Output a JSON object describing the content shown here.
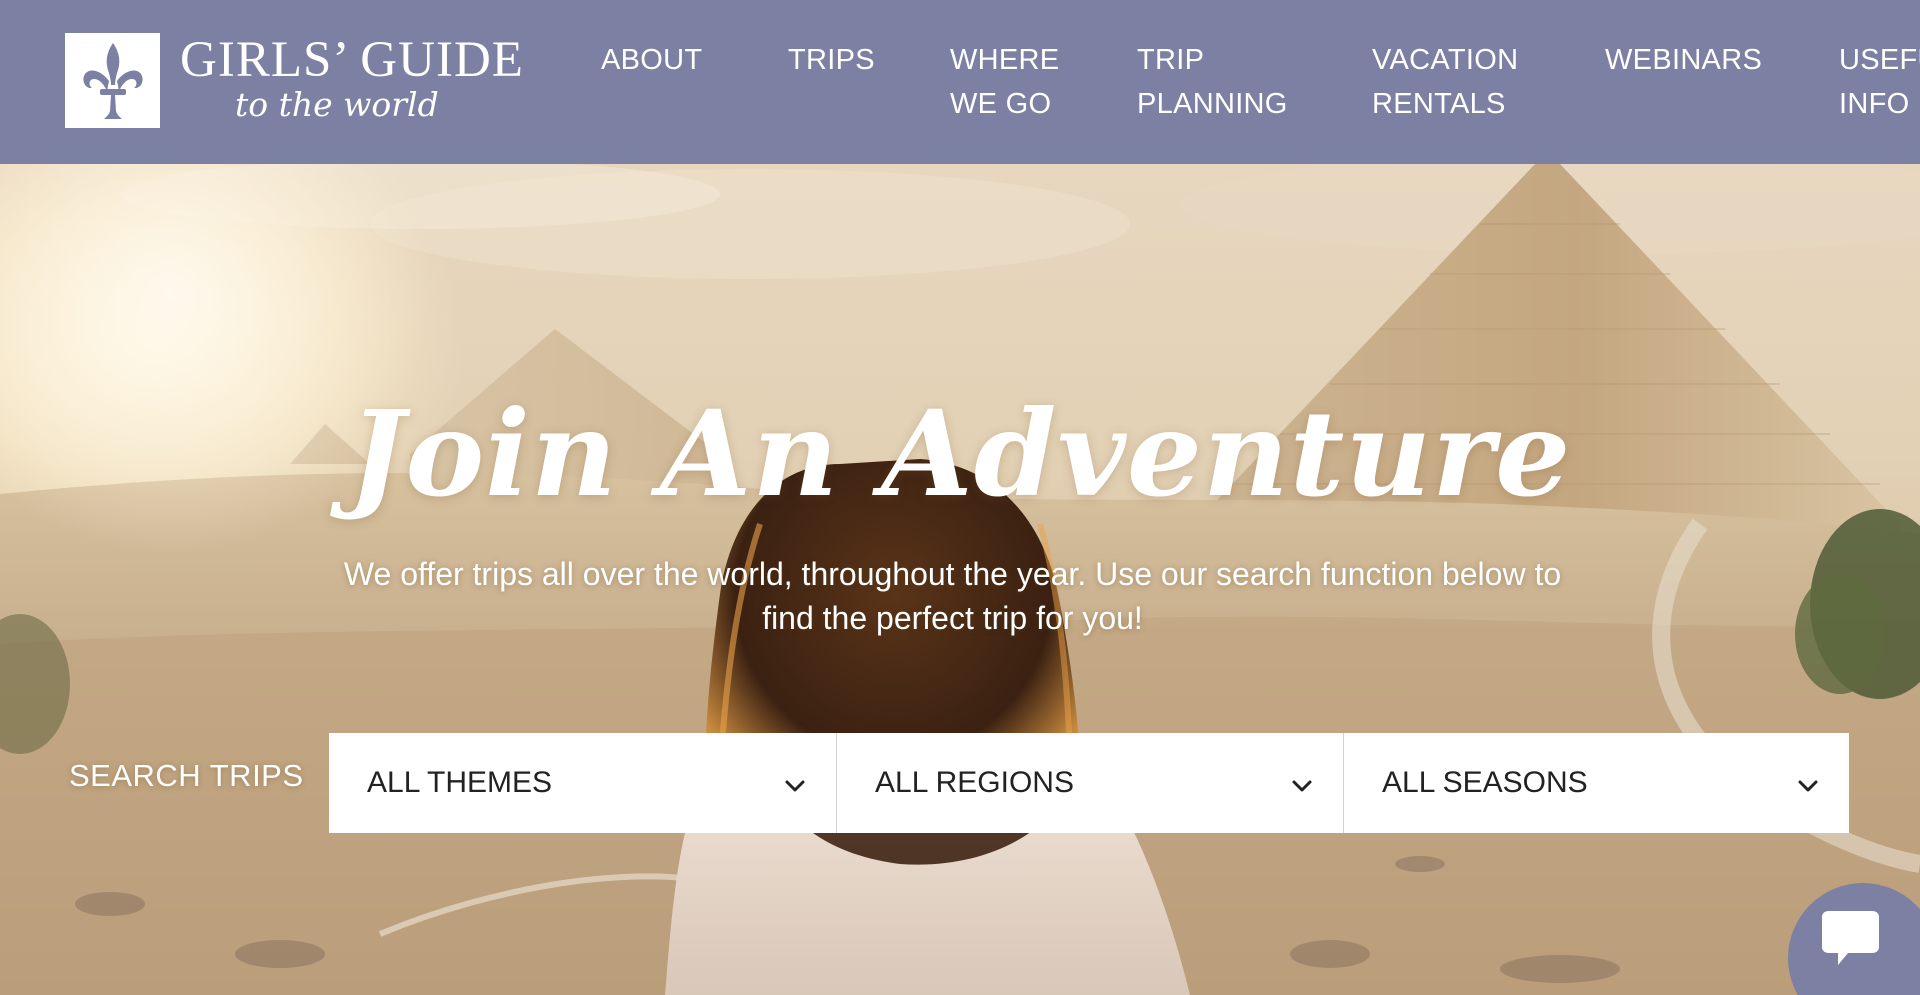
{
  "brand": {
    "logo_icon": "fleur-de-lis-icon",
    "name": "GIRLS’ GUIDE",
    "tagline": "to the world"
  },
  "nav": {
    "items": [
      {
        "line1": "ABOUT",
        "line2": ""
      },
      {
        "line1": "TRIPS",
        "line2": ""
      },
      {
        "line1": "WHERE",
        "line2": "WE GO"
      },
      {
        "line1": "TRIP",
        "line2": "PLANNING"
      },
      {
        "line1": "VACATION",
        "line2": "RENTALS"
      },
      {
        "line1": "WEBINARS",
        "line2": ""
      },
      {
        "line1": "USEFU",
        "line2": "INFO"
      }
    ]
  },
  "hero": {
    "title": "Join An Adventure",
    "subtitle": "We offer trips all over the world, throughout the year. Use our search function below to find the perfect trip for you!"
  },
  "search": {
    "label": "SEARCH TRIPS",
    "themes": "ALL THEMES",
    "regions": "ALL REGIONS",
    "seasons": "ALL SEASONS",
    "dropdown_icon": "chevron-down-icon"
  },
  "chat": {
    "icon": "chat-bubble-icon"
  },
  "colors": {
    "header_bg": "#7c80a3",
    "text_light": "#ffffff",
    "select_text": "#222222"
  }
}
